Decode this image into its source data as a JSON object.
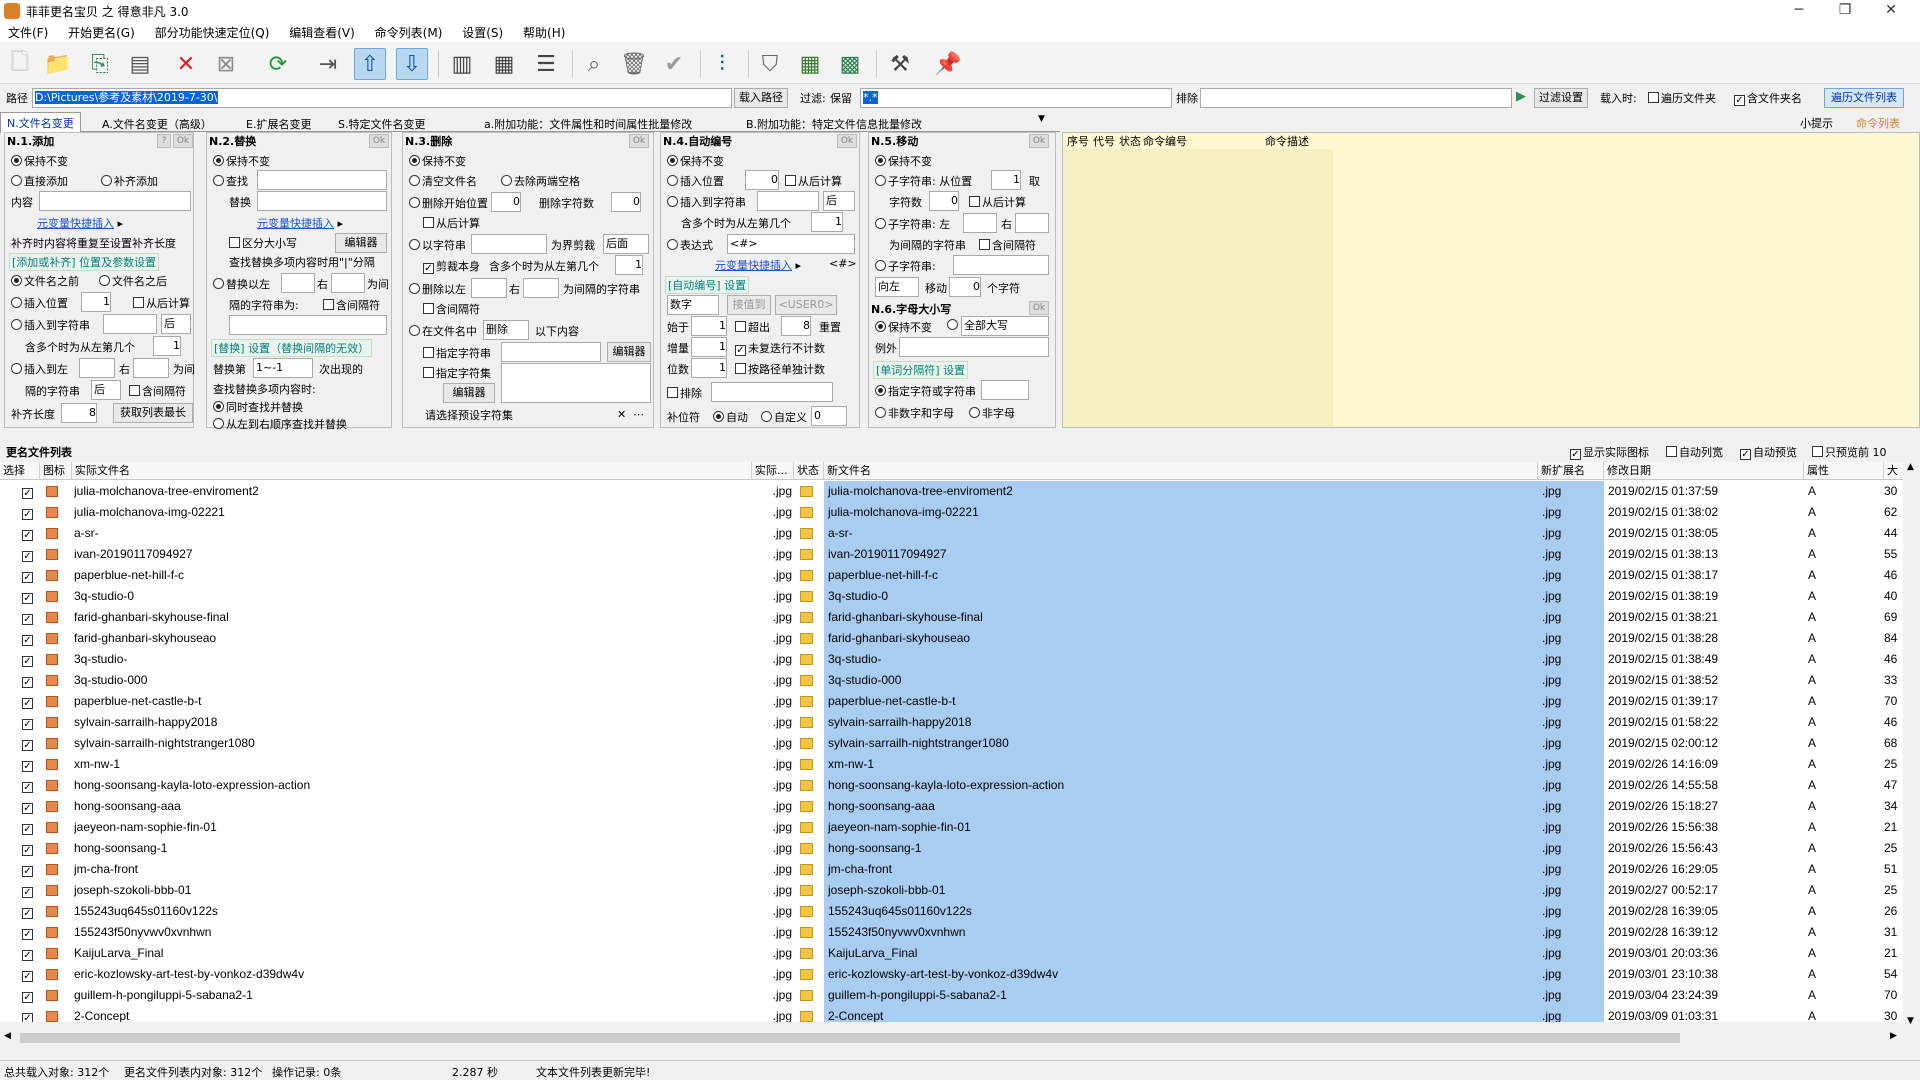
{
  "window": {
    "title": "菲菲更名宝贝 之 得意非凡 3.0",
    "min": "─",
    "max": "❐",
    "close": "✕"
  },
  "menu": [
    "文件(F)",
    "开始更名(G)",
    "部分功能快速定位(Q)",
    "编辑查看(V)",
    "命令列表(M)",
    "设置(S)",
    "帮助(H)"
  ],
  "path": {
    "label": "路径",
    "value": "D:\\Pictures\\参考及素材\\2019-7-30\\",
    "load_btn": "载入路径",
    "filter_label": "过滤:",
    "filter_keep": "保留",
    "filter_value": "*.*",
    "exclude_label": "排除",
    "filter_settings_btn": "过滤设置",
    "load_when": "载入时:",
    "traverse_folder": "遍历文件夹",
    "include_folder_name": "含文件夹名",
    "traverse_list_btn": "遍历文件列表"
  },
  "tabs": [
    "N.文件名变更",
    "A.文件名变更（高级）",
    "E.扩展名变更",
    "S.特定文件名变更",
    "a.附加功能：文件属性和时间属性批量修改",
    "B.附加功能：特定文件信息批量修改"
  ],
  "tabs_right": {
    "tips": "小提示",
    "cmd_list": "命令列表"
  },
  "panel1": {
    "title": "N.1.添加",
    "keep": "保持不变",
    "direct": "直接添加",
    "pad": "补齐添加",
    "content": "内容",
    "var_insert": "元变量快捷插入",
    "pad_note": "补齐时内容将重复至设置补齐长度",
    "section": "[添加或补齐] 位置及参数设置",
    "before": "文件名之前",
    "after": "文件名之后",
    "insert_pos": "插入位置",
    "pos_val": "1",
    "from_end": "从后计算",
    "insert_to_str": "插入到字符串",
    "back": "后",
    "multi": "含多个时为从左第几个",
    "multi_val": "1",
    "insert_left": "插入到左",
    "right": "右",
    "between": "为间",
    "between2": "隔的字符串",
    "back2": "后",
    "include_sep": "含间隔符",
    "pad_len": "补齐长度",
    "pad_val": "8",
    "get_max": "获取列表最长",
    "ok": "Ok",
    "q": "?"
  },
  "panel2": {
    "title": "N.2.替换",
    "keep": "保持不变",
    "find": "查找",
    "replace": "替换",
    "var_insert": "元变量快捷插入",
    "case": "区分大小写",
    "editor": "编辑器",
    "multi_note": "查找替换多项内容时用\"|\"分隔",
    "replace_left": "替换以左",
    "right": "右",
    "between": "为间",
    "between2": "隔的字符串为:",
    "include_sep": "含间隔符",
    "section": "[替换] 设置（替换间隔的无效）",
    "replace_nth": "替换第",
    "nth_val": "1~-1",
    "nth_suffix": "次出现的",
    "multi_find": "查找替换多项内容时:",
    "simul": "同时查找并替换",
    "seq": "从左到右顺序查找并替换",
    "ok": "Ok"
  },
  "panel3": {
    "title": "N.3.删除",
    "keep": "保持不变",
    "clear_name": "清空文件名",
    "trim": "去除两端空格",
    "del_start": "删除开始位置",
    "start_val": "0",
    "del_count": "删除字符数",
    "count_val": "0",
    "from_end": "从后计算",
    "by_str": "以字符串",
    "as_boundary": "为界剪裁",
    "back": "后面",
    "cut_self": "剪裁本身",
    "multi": "含多个时为从左第几个",
    "multi_val": "1",
    "del_left": "删除以左",
    "right": "右",
    "between": "为间隔的字符串",
    "include_sep": "含间隔符",
    "in_name": "在文件名中",
    "delete": "删除",
    "following": "以下内容",
    "spec_str": "指定字符串",
    "editor": "编辑器",
    "spec_set": "指定字符集",
    "editor2": "编辑器",
    "preset_ph": "请选择预设字符集",
    "ok": "Ok"
  },
  "panel4": {
    "title": "N.4.自动编号",
    "keep": "保持不变",
    "insert_pos": "插入位置",
    "pos_val": "0",
    "from_end": "从后计算",
    "insert_str": "插入到字符串",
    "back": "后",
    "multi": "含多个时为从左第几个",
    "multi_val": "1",
    "expr": "表达式",
    "expr_val": "<#>",
    "var_insert": "元变量快捷插入",
    "hash": "<#>",
    "section": "[自动编号] 设置",
    "type": "数字",
    "cont": "接值到",
    "user": "<USER0>",
    "start": "始于",
    "start_val": "1",
    "over": "超出",
    "over_val": "8",
    "reset": "重置",
    "step": "增量",
    "step_val": "1",
    "skip_dup": "未复迭行不计数",
    "digits": "位数",
    "digits_val": "1",
    "by_path": "按路径单独计数",
    "exclude": "排除",
    "pad_pos": "补位符",
    "auto": "自动",
    "custom": "自定义",
    "custom_val": "0",
    "ok": "Ok"
  },
  "panel5": {
    "title": "N.5.移动",
    "keep": "保持不变",
    "substr": "子字符串: 从位置",
    "from_val": "1",
    "take": "取",
    "chars": "字符数",
    "chars_val": "0",
    "from_end": "从后计算",
    "substr_left": "子字符串: 左",
    "right": "右",
    "between": "为间隔的字符串",
    "include_sep": "含间隔符",
    "substr2": "子字符串:",
    "dir": "向左",
    "move": "移动",
    "move_val": "0",
    "unit": "个字符",
    "case_title": "N.6.字母大小写",
    "case_keep": "保持不变",
    "all_upper": "全部大写",
    "example": "例外",
    "word_sep": "[单词分隔符] 设置",
    "spec_str": "指定字符或字符串",
    "non_alnum": "非数字和字母",
    "non_alpha": "非字母",
    "ok": "Ok"
  },
  "cmdlist": {
    "headers": [
      "序号",
      "代号",
      "状态",
      "命令编号",
      "命令描述"
    ]
  },
  "list_title": "更名文件列表",
  "list_options": {
    "show_icon": "显示实际图标",
    "auto_width": "自动列宽",
    "auto_preview": "自动预览",
    "preview_only": "只预览前",
    "preview_n": "10"
  },
  "columns": [
    "选择",
    "图标",
    "实际文件名",
    "实际...",
    "状态",
    "新文件名",
    "新扩展名",
    "修改日期",
    "属性",
    "大"
  ],
  "files": [
    {
      "name": "julia-molchanova-tree-enviroment2",
      "ext": ".jpg",
      "date": "2019/02/15 01:37:59",
      "attr": "A",
      "size": "30"
    },
    {
      "name": "julia-molchanova-img-02221",
      "ext": ".jpg",
      "date": "2019/02/15 01:38:02",
      "attr": "A",
      "size": "62"
    },
    {
      "name": "a-sr-",
      "ext": ".jpg",
      "date": "2019/02/15 01:38:05",
      "attr": "A",
      "size": "44"
    },
    {
      "name": "ivan-20190117094927",
      "ext": ".jpg",
      "date": "2019/02/15 01:38:13",
      "attr": "A",
      "size": "55"
    },
    {
      "name": "paperblue-net-hill-f-c",
      "ext": ".jpg",
      "date": "2019/02/15 01:38:17",
      "attr": "A",
      "size": "46"
    },
    {
      "name": "3q-studio-0",
      "ext": ".jpg",
      "date": "2019/02/15 01:38:19",
      "attr": "A",
      "size": "40"
    },
    {
      "name": "farid-ghanbari-skyhouse-final",
      "ext": ".jpg",
      "date": "2019/02/15 01:38:21",
      "attr": "A",
      "size": "69"
    },
    {
      "name": "farid-ghanbari-skyhouseao",
      "ext": ".jpg",
      "date": "2019/02/15 01:38:28",
      "attr": "A",
      "size": "84"
    },
    {
      "name": "3q-studio-",
      "ext": ".jpg",
      "date": "2019/02/15 01:38:49",
      "attr": "A",
      "size": "46"
    },
    {
      "name": "3q-studio-000",
      "ext": ".jpg",
      "date": "2019/02/15 01:38:52",
      "attr": "A",
      "size": "33"
    },
    {
      "name": "paperblue-net-castle-b-t",
      "ext": ".jpg",
      "date": "2019/02/15 01:39:17",
      "attr": "A",
      "size": "70"
    },
    {
      "name": "sylvain-sarrailh-happy2018",
      "ext": ".jpg",
      "date": "2019/02/15 01:58:22",
      "attr": "A",
      "size": "46"
    },
    {
      "name": "sylvain-sarrailh-nightstranger1080",
      "ext": ".jpg",
      "date": "2019/02/15 02:00:12",
      "attr": "A",
      "size": "68"
    },
    {
      "name": "xm-nw-1",
      "ext": ".jpg",
      "date": "2019/02/26 14:16:09",
      "attr": "A",
      "size": "25"
    },
    {
      "name": "hong-soonsang-kayla-loto-expression-action",
      "ext": ".jpg",
      "date": "2019/02/26 14:55:58",
      "attr": "A",
      "size": "47"
    },
    {
      "name": "hong-soonsang-aaa",
      "ext": ".jpg",
      "date": "2019/02/26 15:18:27",
      "attr": "A",
      "size": "34"
    },
    {
      "name": "jaeyeon-nam-sophie-fin-01",
      "ext": ".jpg",
      "date": "2019/02/26 15:56:38",
      "attr": "A",
      "size": "21"
    },
    {
      "name": "hong-soonsang-1",
      "ext": ".jpg",
      "date": "2019/02/26 15:56:43",
      "attr": "A",
      "size": "25"
    },
    {
      "name": "jm-cha-front",
      "ext": ".jpg",
      "date": "2019/02/26 16:29:05",
      "attr": "A",
      "size": "51"
    },
    {
      "name": "joseph-szokoli-bbb-01",
      "ext": ".jpg",
      "date": "2019/02/27 00:52:17",
      "attr": "A",
      "size": "25"
    },
    {
      "name": "155243uq645s01160v122s",
      "ext": ".jpg",
      "date": "2019/02/28 16:39:05",
      "attr": "A",
      "size": "26"
    },
    {
      "name": "155243f50nyvwv0xvnhwn",
      "ext": ".jpg",
      "date": "2019/02/28 16:39:12",
      "attr": "A",
      "size": "31"
    },
    {
      "name": "KaijuLarva_Final",
      "ext": ".jpg",
      "date": "2019/03/01 20:03:36",
      "attr": "A",
      "size": "21"
    },
    {
      "name": "eric-kozlowsky-art-test-by-vonkoz-d39dw4v",
      "ext": ".jpg",
      "date": "2019/03/01 23:10:38",
      "attr": "A",
      "size": "54"
    },
    {
      "name": "guillem-h-pongiluppi-5-sabana2-1",
      "ext": ".jpg",
      "date": "2019/03/04 23:24:39",
      "attr": "A",
      "size": "70"
    },
    {
      "name": "2-Concept",
      "ext": ".jpg",
      "date": "2019/03/09 01:03:31",
      "attr": "A",
      "size": "30"
    }
  ],
  "status": {
    "total": "总共载入对象: 312个",
    "list_count": "更名文件列表内对象: 312个",
    "ops": "操作记录: 0条",
    "time": "2.287 秒",
    "msg": "文本文件列表更新完毕!"
  }
}
